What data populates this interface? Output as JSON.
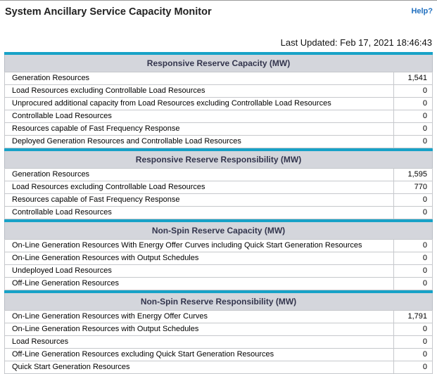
{
  "header": {
    "title": "System Ancillary Service Capacity Monitor",
    "help_label": "Help?",
    "last_updated": "Last Updated: Feb 17, 2021 18:46:43"
  },
  "sections": [
    {
      "title": "Responsive Reserve Capacity (MW)",
      "rows": [
        {
          "label": "Generation Resources",
          "value": "1,541"
        },
        {
          "label": "Load Resources excluding Controllable Load Resources",
          "value": "0"
        },
        {
          "label": "Unprocured additional capacity from Load Resources excluding Controllable Load Resources",
          "value": "0"
        },
        {
          "label": "Controllable Load Resources",
          "value": "0"
        },
        {
          "label": "Resources capable of Fast Frequency Response",
          "value": "0"
        },
        {
          "label": "Deployed Generation Resources and Controllable Load Resources",
          "value": "0"
        }
      ]
    },
    {
      "title": "Responsive Reserve Responsibility (MW)",
      "rows": [
        {
          "label": "Generation Resources",
          "value": "1,595"
        },
        {
          "label": "Load Resources excluding Controllable Load Resources",
          "value": "770"
        },
        {
          "label": "Resources capable of Fast Frequency Response",
          "value": "0"
        },
        {
          "label": "Controllable Load Resources",
          "value": "0"
        }
      ]
    },
    {
      "title": "Non-Spin Reserve Capacity (MW)",
      "rows": [
        {
          "label": "On-Line Generation Resources With Energy Offer Curves including Quick Start Generation Resources",
          "value": "0"
        },
        {
          "label": "On-Line Generation Resources with Output Schedules",
          "value": "0"
        },
        {
          "label": "Undeployed Load Resources",
          "value": "0"
        },
        {
          "label": "Off-Line Generation Resources",
          "value": "0"
        }
      ]
    },
    {
      "title": "Non-Spin Reserve Responsibility (MW)",
      "rows": [
        {
          "label": "On-Line Generation Resources with Energy Offer Curves",
          "value": "1,791"
        },
        {
          "label": "On-Line Generation Resources with Output Schedules",
          "value": "0"
        },
        {
          "label": "Load Resources",
          "value": "0"
        },
        {
          "label": "Off-Line Generation Resources excluding Quick Start Generation Resources",
          "value": "0"
        },
        {
          "label": "Quick Start Generation Resources",
          "value": "0"
        }
      ]
    }
  ]
}
